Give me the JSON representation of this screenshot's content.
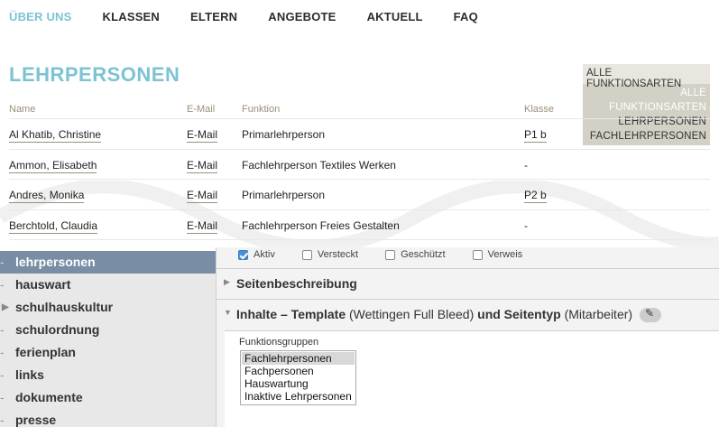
{
  "nav": {
    "items": [
      {
        "label": "ÜBER UNS",
        "active": true
      },
      {
        "label": "KLASSEN",
        "active": false
      },
      {
        "label": "ELTERN",
        "active": false
      },
      {
        "label": "ANGEBOTE",
        "active": false
      },
      {
        "label": "AKTUELL",
        "active": false
      },
      {
        "label": "FAQ",
        "active": false
      }
    ]
  },
  "page": {
    "title": "LEHRPERSONEN"
  },
  "filter": {
    "selected": "ALLE FUNKTIONSARTEN",
    "options": [
      "ALLE FUNKTIONSARTEN",
      "LEHRPERSONEN",
      "FACHLEHRPERSONEN"
    ]
  },
  "table": {
    "headers": {
      "name": "Name",
      "email": "E-Mail",
      "funktion": "Funktion",
      "klasse": "Klasse"
    },
    "rows": [
      {
        "name": "Al Khatib, Christine",
        "email": "E-Mail",
        "funktion": "Primarlehrperson",
        "klasse": "P1 b"
      },
      {
        "name": "Ammon, Elisabeth",
        "email": "E-Mail",
        "funktion": "Fachlehrperson Textiles Werken",
        "klasse": "-"
      },
      {
        "name": "Andres, Monika",
        "email": "E-Mail",
        "funktion": "Primarlehrperson",
        "klasse": "P2 b"
      },
      {
        "name": "Berchtold, Claudia",
        "email": "E-Mail",
        "funktion": "Fachlehrperson Freies Gestalten",
        "klasse": "-"
      }
    ]
  },
  "sidebar": {
    "items": [
      {
        "label": "lehrpersonen",
        "marker": "-"
      },
      {
        "label": "hauswart",
        "marker": "-"
      },
      {
        "label": "schulhauskultur",
        "marker": "▶"
      },
      {
        "label": "schulordnung",
        "marker": "-"
      },
      {
        "label": "ferienplan",
        "marker": "-"
      },
      {
        "label": "links",
        "marker": "-"
      },
      {
        "label": "dokumente",
        "marker": "-"
      },
      {
        "label": "presse",
        "marker": "-"
      }
    ]
  },
  "checkboxes": [
    {
      "label": "Aktiv",
      "checked": true
    },
    {
      "label": "Versteckt",
      "checked": false
    },
    {
      "label": "Geschützt",
      "checked": false
    },
    {
      "label": "Verweis",
      "checked": false
    }
  ],
  "sections": {
    "seitenbeschreibung": "Seitenbeschreibung",
    "inhalte_bold1": "Inhalte – Template",
    "inhalte_normal1": " (Wettingen Full Bleed) ",
    "inhalte_bold2": "und Seitentyp",
    "inhalte_normal2": " (Mitarbeiter)"
  },
  "funktionsgruppen": {
    "label": "Funktionsgruppen",
    "options": [
      "Fachlehrpersonen",
      "Fachpersonen",
      "Hauswartung",
      "Inaktive Lehrpersonen"
    ],
    "selected_index": 0
  },
  "colors": {
    "accent": "#7cc3d3",
    "sidebar_active": "#788ea5",
    "checkbox_on": "#4a90d9"
  }
}
